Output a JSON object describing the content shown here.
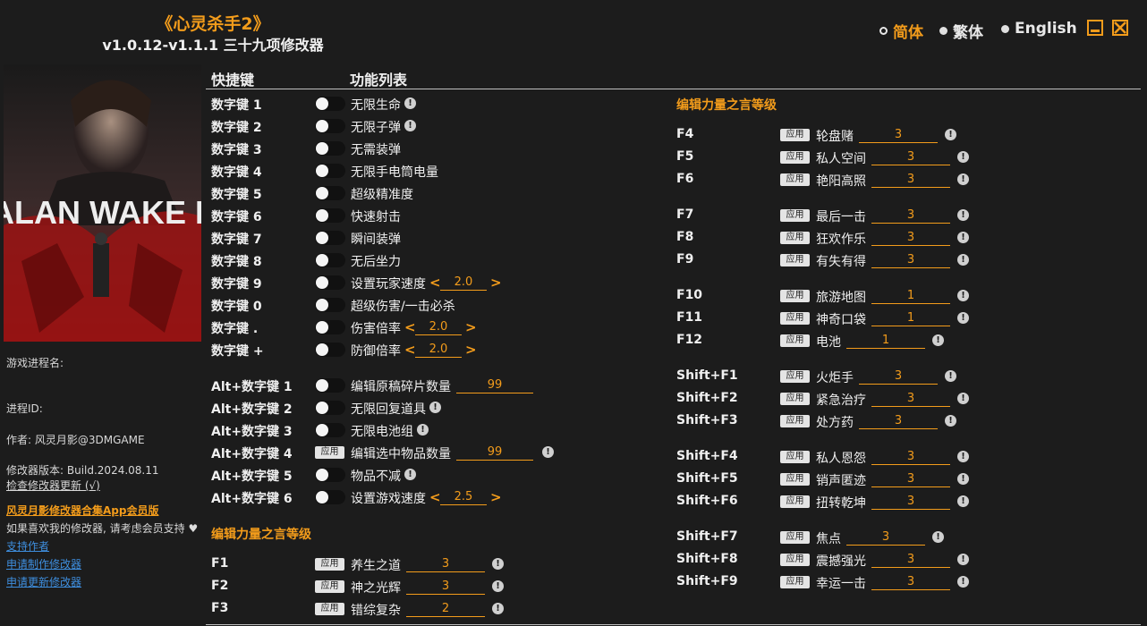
{
  "header": {
    "title": "《心灵杀手2》",
    "subtitle": "v1.0.12-v1.1.1 三十九项修改器",
    "languages": [
      {
        "label": "简体",
        "selected": true
      },
      {
        "label": "繁体",
        "selected": false
      },
      {
        "label": "English",
        "selected": false
      }
    ],
    "accent_color": "#f39c1b"
  },
  "cover": {
    "game_title": "ALAN WAKE II"
  },
  "sidebar": {
    "process_name_label": "游戏进程名:",
    "process_id_label": "进程ID:",
    "author": "作者: 风灵月影@3DMGAME",
    "version": "修改器版本: Build.2024.08.11",
    "check_update": "检查修改器更新 (√)",
    "vip_link": "风灵月影修改器合集App会员版",
    "support_text": "如果喜欢我的修改器, 请考虑会员支持",
    "links": [
      "支持作者",
      "申请制作修改器",
      "申请更新修改器"
    ]
  },
  "columns": {
    "hotkey_header": "快捷键",
    "feature_header": "功能列表"
  },
  "left_rows": [
    {
      "key": "数字键 1",
      "label": "无限生命",
      "control": "toggle",
      "info": true
    },
    {
      "key": "数字键 2",
      "label": "无限子弹",
      "control": "toggle",
      "info": true
    },
    {
      "key": "数字键 3",
      "label": "无需装弹",
      "control": "toggle",
      "info": false
    },
    {
      "key": "数字键 4",
      "label": "无限手电筒电量",
      "control": "toggle",
      "info": false
    },
    {
      "key": "数字键 5",
      "label": "超级精准度",
      "control": "toggle",
      "info": false
    },
    {
      "key": "数字键 6",
      "label": "快速射击",
      "control": "toggle",
      "info": false
    },
    {
      "key": "数字键 7",
      "label": "瞬间装弹",
      "control": "toggle",
      "info": false
    },
    {
      "key": "数字键 8",
      "label": "无后坐力",
      "control": "toggle",
      "info": false
    },
    {
      "key": "数字键 9",
      "label": "设置玩家速度",
      "control": "toggle",
      "stepper": "2.0"
    },
    {
      "key": "数字键 0",
      "label": "超级伤害/一击必杀",
      "control": "toggle",
      "info": false
    },
    {
      "key": "数字键 .",
      "label": "伤害倍率",
      "control": "toggle",
      "stepper": "2.0"
    },
    {
      "key": "数字键 +",
      "label": "防御倍率",
      "control": "toggle",
      "stepper": "2.0"
    }
  ],
  "alt_rows": [
    {
      "key": "Alt+数字键 1",
      "label": "编辑原稿碎片数量",
      "control": "toggle",
      "value": "99"
    },
    {
      "key": "Alt+数字键 2",
      "label": "无限回复道具",
      "control": "toggle",
      "info": true
    },
    {
      "key": "Alt+数字键 3",
      "label": "无限电池组",
      "control": "toggle",
      "info": true
    },
    {
      "key": "Alt+数字键 4",
      "label": "编辑选中物品数量",
      "control": "apply",
      "value": "99",
      "info": true
    },
    {
      "key": "Alt+数字键 5",
      "label": "物品不减",
      "control": "toggle",
      "info": true
    },
    {
      "key": "Alt+数字键 6",
      "label": "设置游戏速度",
      "control": "toggle",
      "stepper": "2.5"
    }
  ],
  "section_title": "编辑力量之言等级",
  "apply_label": "应用",
  "left_f_rows": [
    {
      "key": "F1",
      "label": "养生之道",
      "value": "3"
    },
    {
      "key": "F2",
      "label": "神之光辉",
      "value": "3"
    },
    {
      "key": "F3",
      "label": "错综复杂",
      "value": "2"
    }
  ],
  "right_rows": [
    {
      "key": "F4",
      "label": "轮盘赌",
      "value": "3"
    },
    {
      "key": "F5",
      "label": "私人空间",
      "value": "3"
    },
    {
      "key": "F6",
      "label": "艳阳高照",
      "value": "3"
    },
    {
      "key": "F7",
      "label": "最后一击",
      "value": "3"
    },
    {
      "key": "F8",
      "label": "狂欢作乐",
      "value": "3"
    },
    {
      "key": "F9",
      "label": "有失有得",
      "value": "3"
    },
    {
      "key": "F10",
      "label": "旅游地图",
      "value": "1"
    },
    {
      "key": "F11",
      "label": "神奇口袋",
      "value": "1"
    },
    {
      "key": "F12",
      "label": "电池",
      "value": "1"
    },
    {
      "key": "Shift+F1",
      "label": "火炬手",
      "value": "3"
    },
    {
      "key": "Shift+F2",
      "label": "紧急治疗",
      "value": "3"
    },
    {
      "key": "Shift+F3",
      "label": "处方药",
      "value": "3"
    },
    {
      "key": "Shift+F4",
      "label": "私人恩怨",
      "value": "3"
    },
    {
      "key": "Shift+F5",
      "label": "销声匿迹",
      "value": "3"
    },
    {
      "key": "Shift+F6",
      "label": "扭转乾坤",
      "value": "3"
    },
    {
      "key": "Shift+F7",
      "label": "焦点",
      "value": "3"
    },
    {
      "key": "Shift+F8",
      "label": "震撼强光",
      "value": "3"
    },
    {
      "key": "Shift+F9",
      "label": "幸运一击",
      "value": "3"
    }
  ]
}
